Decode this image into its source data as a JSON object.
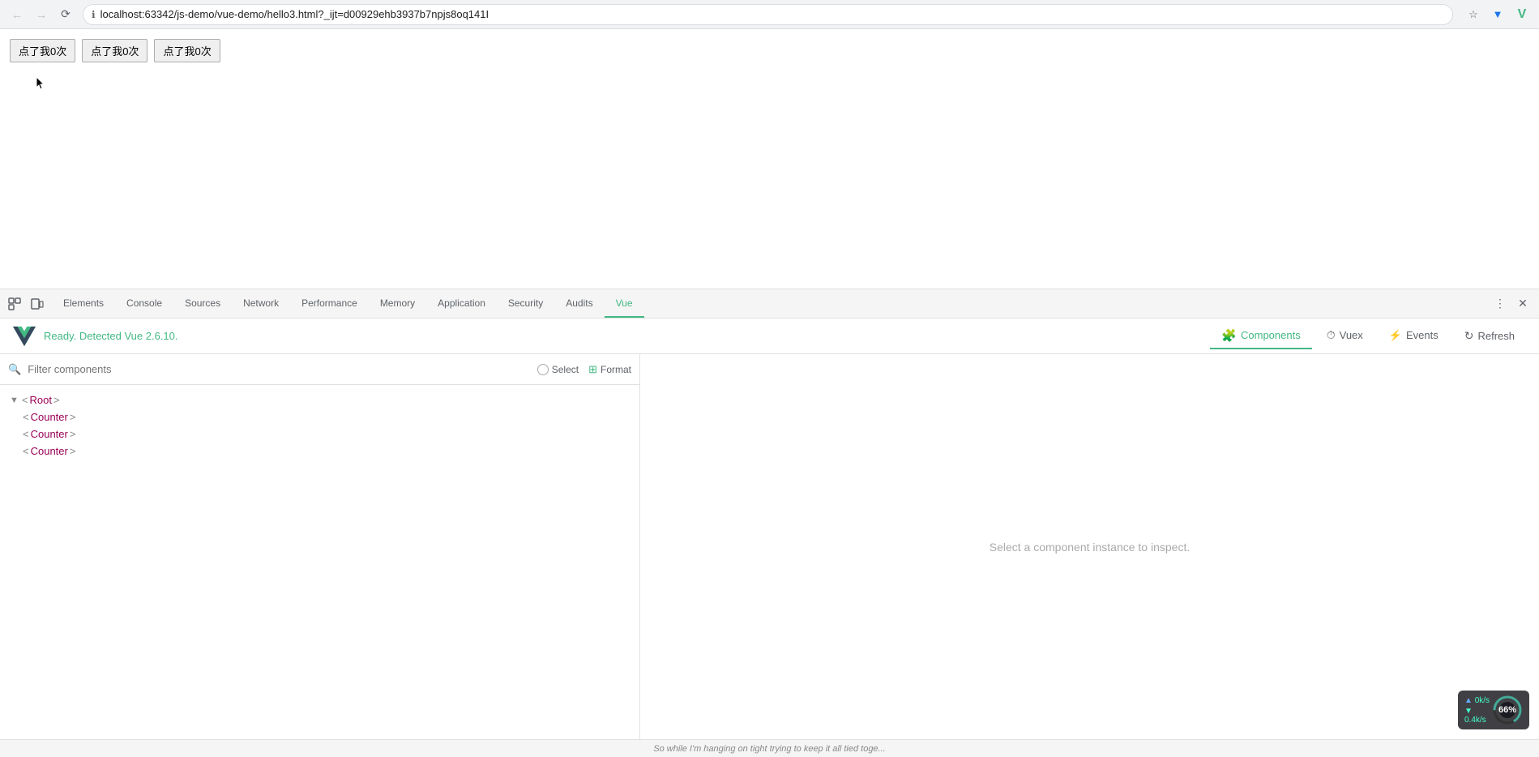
{
  "browser": {
    "url": "localhost:63342/js-demo/vue-demo/hello3.html?_ijt=d00929ehb3937b7npjs8oq141I",
    "back_disabled": true,
    "forward_disabled": true
  },
  "page": {
    "buttons": [
      "点了我0次",
      "点了我0次",
      "点了我0次"
    ]
  },
  "devtools": {
    "tabs": [
      {
        "label": "Elements",
        "active": false
      },
      {
        "label": "Console",
        "active": false
      },
      {
        "label": "Sources",
        "active": false
      },
      {
        "label": "Network",
        "active": false
      },
      {
        "label": "Performance",
        "active": false
      },
      {
        "label": "Memory",
        "active": false
      },
      {
        "label": "Application",
        "active": false
      },
      {
        "label": "Security",
        "active": false
      },
      {
        "label": "Audits",
        "active": false
      },
      {
        "label": "Vue",
        "active": true
      }
    ]
  },
  "vue": {
    "ready_text": "Ready. Detected Vue 2.6.10.",
    "toolbar_tabs": [
      {
        "label": "Components",
        "active": true,
        "icon": "🧩"
      },
      {
        "label": "Vuex",
        "active": false,
        "icon": "⏱"
      },
      {
        "label": "Events",
        "active": false,
        "icon": "⚡"
      },
      {
        "label": "Refresh",
        "active": false,
        "icon": "↻"
      }
    ],
    "filter_placeholder": "Filter components",
    "select_label": "Select",
    "format_label": "Format",
    "component_tree": [
      {
        "label": "<Root>",
        "indent": 0,
        "has_arrow": true,
        "arrow_dir": "▼"
      },
      {
        "label": "<Counter>",
        "indent": 1,
        "has_arrow": false
      },
      {
        "label": "<Counter>",
        "indent": 1,
        "has_arrow": false
      },
      {
        "label": "<Counter>",
        "indent": 1,
        "has_arrow": false
      }
    ],
    "inspect_hint": "Select a component instance to inspect.",
    "perf": {
      "up_label": "0k/s",
      "down_label": "0.4k/s",
      "gauge_value": 66,
      "gauge_label": "66%"
    }
  },
  "bottom_hint": "So while I'm hanging on tight trying to keep it all tied toge..."
}
